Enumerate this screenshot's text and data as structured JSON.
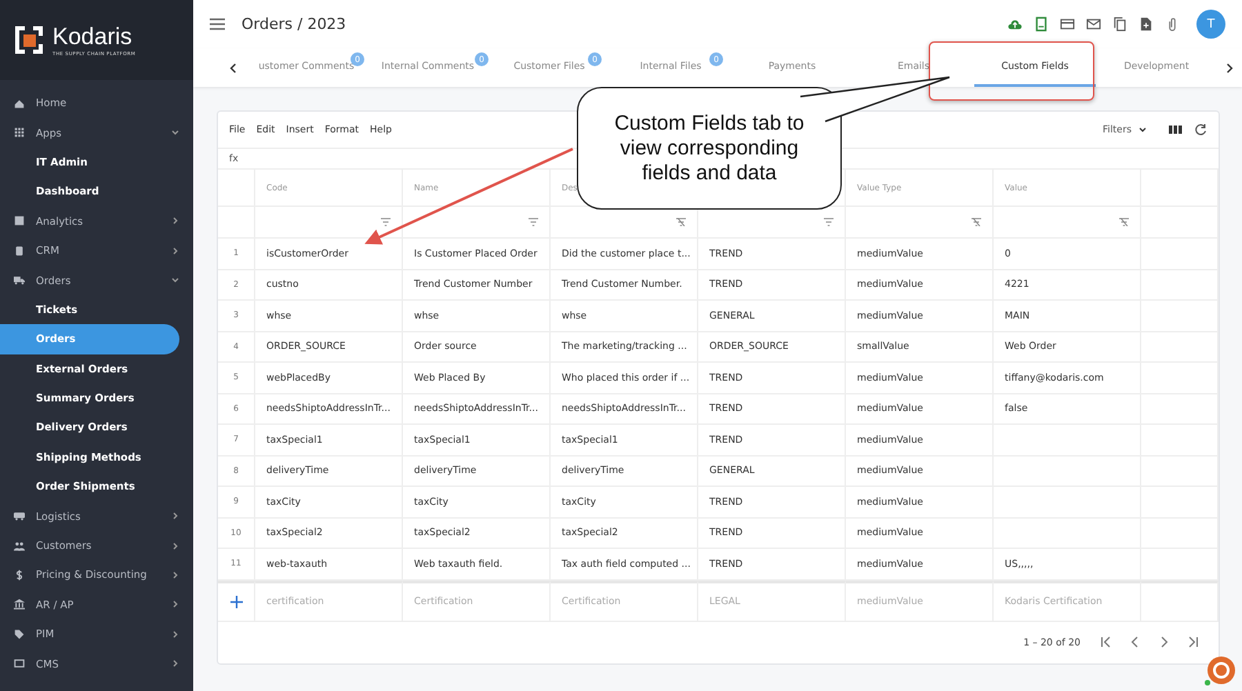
{
  "brand": {
    "name": "Kodaris",
    "tagline": "THE SUPPLY CHAIN PLATFORM"
  },
  "sidebar": {
    "items": [
      {
        "label": "Home",
        "kind": "home"
      },
      {
        "label": "Apps",
        "kind": "grid",
        "expanded": true,
        "children": [
          {
            "label": "IT Admin",
            "selected": false
          },
          {
            "label": "Dashboard",
            "selected": false
          }
        ]
      },
      {
        "label": "Analytics",
        "kind": "chart",
        "expanded": false
      },
      {
        "label": "CRM",
        "kind": "contact",
        "expanded": false
      },
      {
        "label": "Orders",
        "kind": "truck",
        "expanded": true,
        "children": [
          {
            "label": "Tickets",
            "selected": false
          },
          {
            "label": "Orders",
            "selected": true
          },
          {
            "label": "External Orders",
            "selected": false
          },
          {
            "label": "Summary Orders",
            "selected": false
          },
          {
            "label": "Delivery Orders",
            "selected": false
          },
          {
            "label": "Shipping Methods",
            "selected": false
          },
          {
            "label": "Order Shipments",
            "selected": false
          }
        ]
      },
      {
        "label": "Logistics",
        "kind": "van",
        "expanded": false
      },
      {
        "label": "Customers",
        "kind": "people",
        "expanded": false
      },
      {
        "label": "Pricing & Discounting",
        "kind": "dollar",
        "expanded": false
      },
      {
        "label": "AR / AP",
        "kind": "bank",
        "expanded": false
      },
      {
        "label": "PIM",
        "kind": "tag",
        "expanded": false
      },
      {
        "label": "CMS",
        "kind": "window",
        "expanded": false
      }
    ]
  },
  "header": {
    "title": "Orders / 2023",
    "avatar": "T"
  },
  "tabs": [
    {
      "label": "ustomer Comments",
      "badge": "0",
      "selected": false
    },
    {
      "label": "Internal Comments",
      "badge": "0",
      "selected": false
    },
    {
      "label": "Customer Files",
      "badge": "0",
      "selected": false
    },
    {
      "label": "Internal Files",
      "badge": "0",
      "selected": false
    },
    {
      "label": "Payments",
      "selected": false
    },
    {
      "label": "Emails",
      "selected": false
    },
    {
      "label": "Custom Fields",
      "selected": true
    },
    {
      "label": "Development",
      "selected": false
    }
  ],
  "grid": {
    "menu": [
      "File",
      "Edit",
      "Insert",
      "Format",
      "Help"
    ],
    "filters_label": "Filters",
    "formula_label": "fx",
    "columns": [
      {
        "label": "Code",
        "filterable": true
      },
      {
        "label": "Name",
        "filterable": true
      },
      {
        "label": "Des",
        "filterable": false
      },
      {
        "filterable": true
      },
      {
        "label": "Value Type",
        "filterable": false
      },
      {
        "label": "Value",
        "filterable": false
      },
      {}
    ],
    "rows": [
      {
        "num": "1",
        "cells": [
          "isCustomerOrder",
          "Is Customer Placed Order",
          "Did the customer place t...",
          "TREND",
          "mediumValue",
          "0"
        ]
      },
      {
        "num": "2",
        "cells": [
          "custno",
          "Trend Customer Number",
          "Trend Customer Number.",
          "TREND",
          "mediumValue",
          "4221"
        ]
      },
      {
        "num": "3",
        "cells": [
          "whse",
          "whse",
          "whse",
          "GENERAL",
          "mediumValue",
          "MAIN"
        ]
      },
      {
        "num": "4",
        "cells": [
          "ORDER_SOURCE",
          "Order source",
          "The marketing/tracking ...",
          "ORDER_SOURCE",
          "smallValue",
          "Web Order"
        ]
      },
      {
        "num": "5",
        "cells": [
          "webPlacedBy",
          "Web Placed By",
          "Who placed this order if ...",
          "TREND",
          "mediumValue",
          "tiffany@kodaris.com"
        ]
      },
      {
        "num": "6",
        "cells": [
          "needsShiptoAddressInTr...",
          "needsShiptoAddressInTr...",
          "needsShiptoAddressInTr...",
          "TREND",
          "mediumValue",
          "false"
        ]
      },
      {
        "num": "7",
        "cells": [
          "taxSpecial1",
          "taxSpecial1",
          "taxSpecial1",
          "TREND",
          "mediumValue",
          ""
        ]
      },
      {
        "num": "8",
        "cells": [
          "deliveryTime",
          "deliveryTime",
          "deliveryTime",
          "GENERAL",
          "mediumValue",
          ""
        ]
      },
      {
        "num": "9",
        "cells": [
          "taxCity",
          "taxCity",
          "taxCity",
          "TREND",
          "mediumValue",
          ""
        ]
      },
      {
        "num": "10",
        "cells": [
          "taxSpecial2",
          "taxSpecial2",
          "taxSpecial2",
          "TREND",
          "mediumValue",
          ""
        ]
      },
      {
        "num": "11",
        "cells": [
          "web-taxauth",
          "Web taxauth field.",
          "Tax auth field computed ...",
          "TREND",
          "mediumValue",
          "US,,,,,"
        ]
      }
    ],
    "new_row": [
      "certification",
      "Certification",
      "Certification",
      "LEGAL",
      "mediumValue",
      "Kodaris Certification"
    ],
    "pagination": "1 – 20 of 20"
  },
  "callout": {
    "text": "Custom Fields tab to view corresponding fields and data"
  }
}
